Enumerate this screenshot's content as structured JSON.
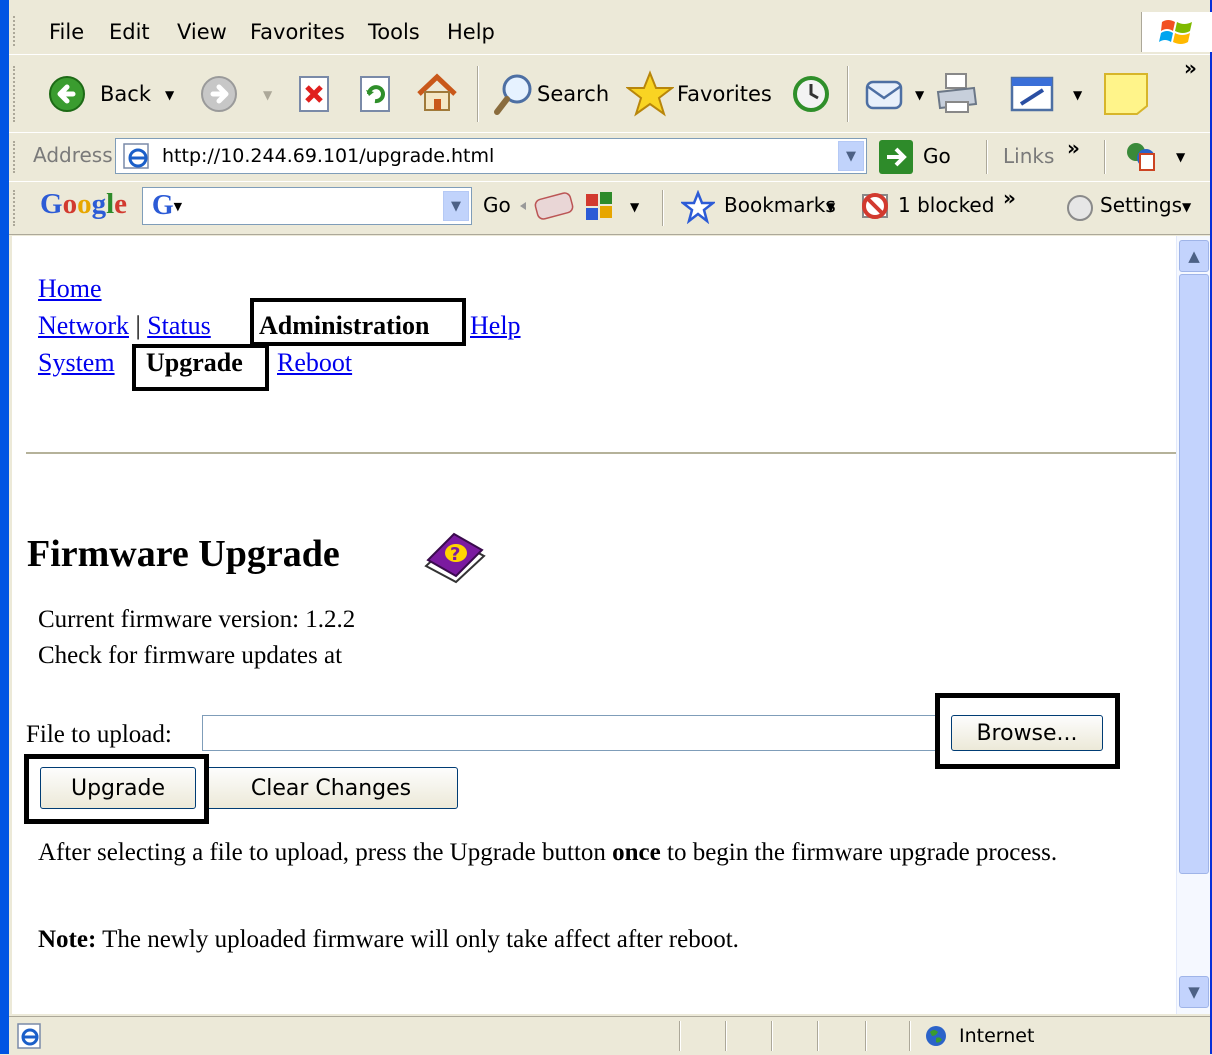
{
  "menu": {
    "items": [
      "File",
      "Edit",
      "View",
      "Favorites",
      "Tools",
      "Help"
    ]
  },
  "toolbar": {
    "back_label": "Back",
    "search_label": "Search",
    "favorites_label": "Favorites",
    "overflow": "»"
  },
  "address_bar": {
    "label": "Address",
    "url": "http://10.244.69.101/upgrade.html",
    "go_label": "Go",
    "links_label": "Links"
  },
  "google_bar": {
    "logo": "Google",
    "go_label": "Go",
    "bookmarks_label": "Bookmarks",
    "blocked_label": "1 blocked",
    "settings_label": "Settings"
  },
  "page": {
    "nav": {
      "home": "Home",
      "network": "Network",
      "separator": "|",
      "status": "Status",
      "administration": "Administration",
      "help": "Help",
      "system": "System",
      "upgrade": "Upgrade",
      "reboot": "Reboot"
    },
    "title": "Firmware Upgrade",
    "current_version": "Current firmware version: 1.2.2",
    "check_updates": "Check for firmware updates at",
    "file_label": "File to upload:",
    "file_value": "",
    "browse_label": "Browse...",
    "upgrade_label": "Upgrade",
    "clear_label": "Clear Changes",
    "instructions_pre": "After selecting a file to upload, press the Upgrade button ",
    "instructions_bold": "once",
    "instructions_post": " to begin the firmware upgrade process.",
    "note_label": "Note:",
    "note_text": " The newly uploaded firmware will only take affect after reboot."
  },
  "status_bar": {
    "zone": "Internet"
  }
}
